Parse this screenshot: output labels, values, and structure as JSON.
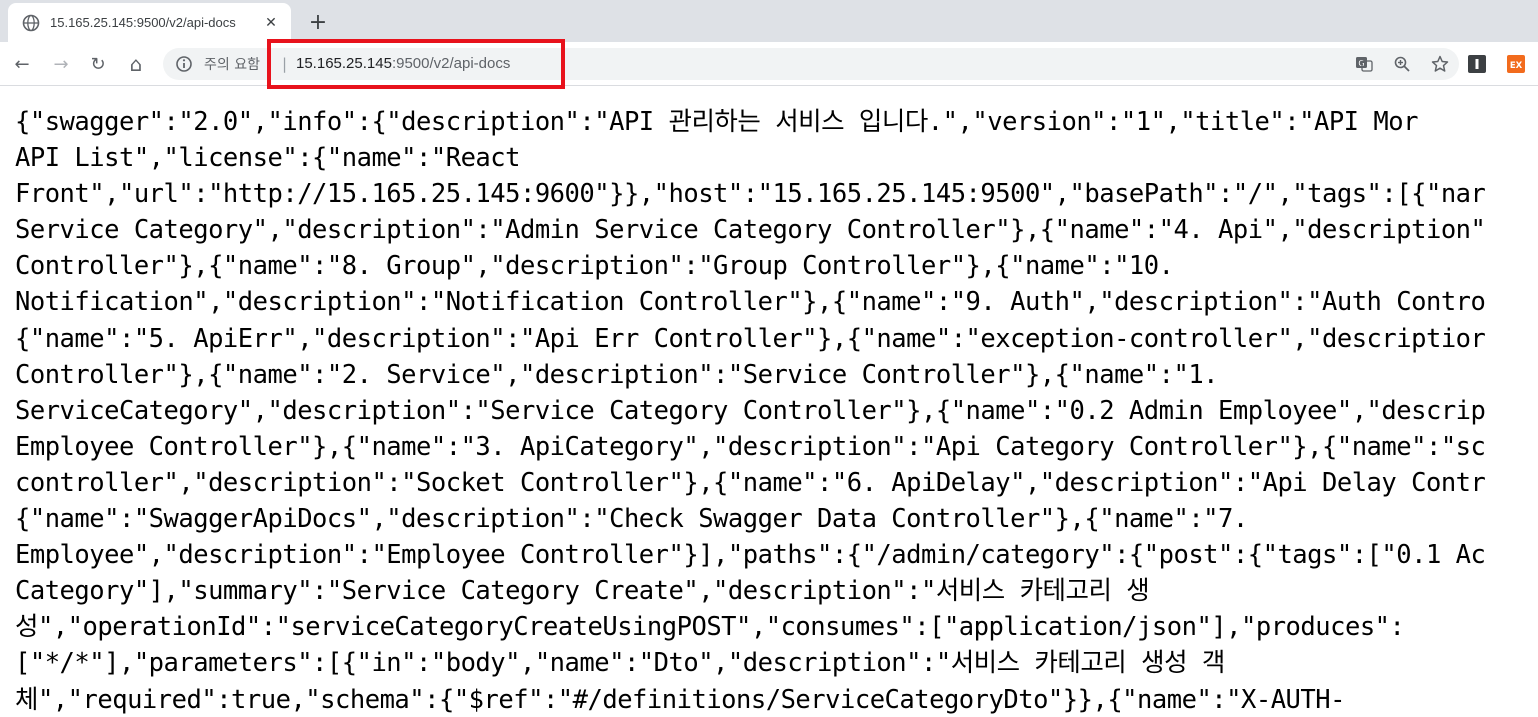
{
  "browser": {
    "tab": {
      "title": "15.165.25.145:9500/v2/api-docs",
      "close_glyph": "✕",
      "icon": "globe-icon"
    },
    "new_tab_glyph": "+",
    "toolbar": {
      "back_glyph": "←",
      "forward_glyph": "→",
      "reload_glyph": "↻",
      "home_glyph": "⌂"
    },
    "omnibox": {
      "security_text": "주의 요함",
      "separator": "|",
      "url_host": "15.165.25.145",
      "url_rest": ":9500/v2/api-docs",
      "icons": [
        "translate-icon",
        "zoom-icon",
        "bookmark-star-icon"
      ]
    },
    "extensions": [
      {
        "name": "extension-i-icon",
        "label": "I",
        "color": "#3c4043"
      },
      {
        "name": "extension-ex-icon",
        "label": "EX",
        "color": "#f26b1d"
      }
    ]
  },
  "annotation": {
    "color": "#e8121c"
  },
  "content": {
    "lines": [
      "{\"swagger\":\"2.0\",\"info\":{\"description\":\"API 관리하는 서비스 입니다.\",\"version\":\"1\",\"title\":\"API Mor",
      "API List\",\"license\":{\"name\":\"React",
      "Front\",\"url\":\"http://15.165.25.145:9600\"}},\"host\":\"15.165.25.145:9500\",\"basePath\":\"/\",\"tags\":[{\"nar",
      "Service Category\",\"description\":\"Admin Service Category Controller\"},{\"name\":\"4. Api\",\"description\"",
      "Controller\"},{\"name\":\"8. Group\",\"description\":\"Group Controller\"},{\"name\":\"10.",
      "Notification\",\"description\":\"Notification Controller\"},{\"name\":\"9. Auth\",\"description\":\"Auth Contro",
      "{\"name\":\"5. ApiErr\",\"description\":\"Api Err Controller\"},{\"name\":\"exception-controller\",\"descriptior",
      "Controller\"},{\"name\":\"2. Service\",\"description\":\"Service Controller\"},{\"name\":\"1.",
      "ServiceCategory\",\"description\":\"Service Category Controller\"},{\"name\":\"0.2 Admin Employee\",\"descrip",
      "Employee Controller\"},{\"name\":\"3. ApiCategory\",\"description\":\"Api Category Controller\"},{\"name\":\"sc",
      "controller\",\"description\":\"Socket Controller\"},{\"name\":\"6. ApiDelay\",\"description\":\"Api Delay Contr",
      "{\"name\":\"SwaggerApiDocs\",\"description\":\"Check Swagger Data Controller\"},{\"name\":\"7.",
      "Employee\",\"description\":\"Employee Controller\"}],\"paths\":{\"/admin/category\":{\"post\":{\"tags\":[\"0.1 Ac",
      "Category\"],\"summary\":\"Service Category Create\",\"description\":\"서비스 카테고리 생",
      "성\",\"operationId\":\"serviceCategoryCreateUsingPOST\",\"consumes\":[\"application/json\"],\"produces\":",
      "[\"*/*\"],\"parameters\":[{\"in\":\"body\",\"name\":\"Dto\",\"description\":\"서비스 카테고리 생성 객",
      "체\",\"required\":true,\"schema\":{\"$ref\":\"#/definitions/ServiceCategoryDto\"}},{\"name\":\"X-AUTH-"
    ]
  }
}
